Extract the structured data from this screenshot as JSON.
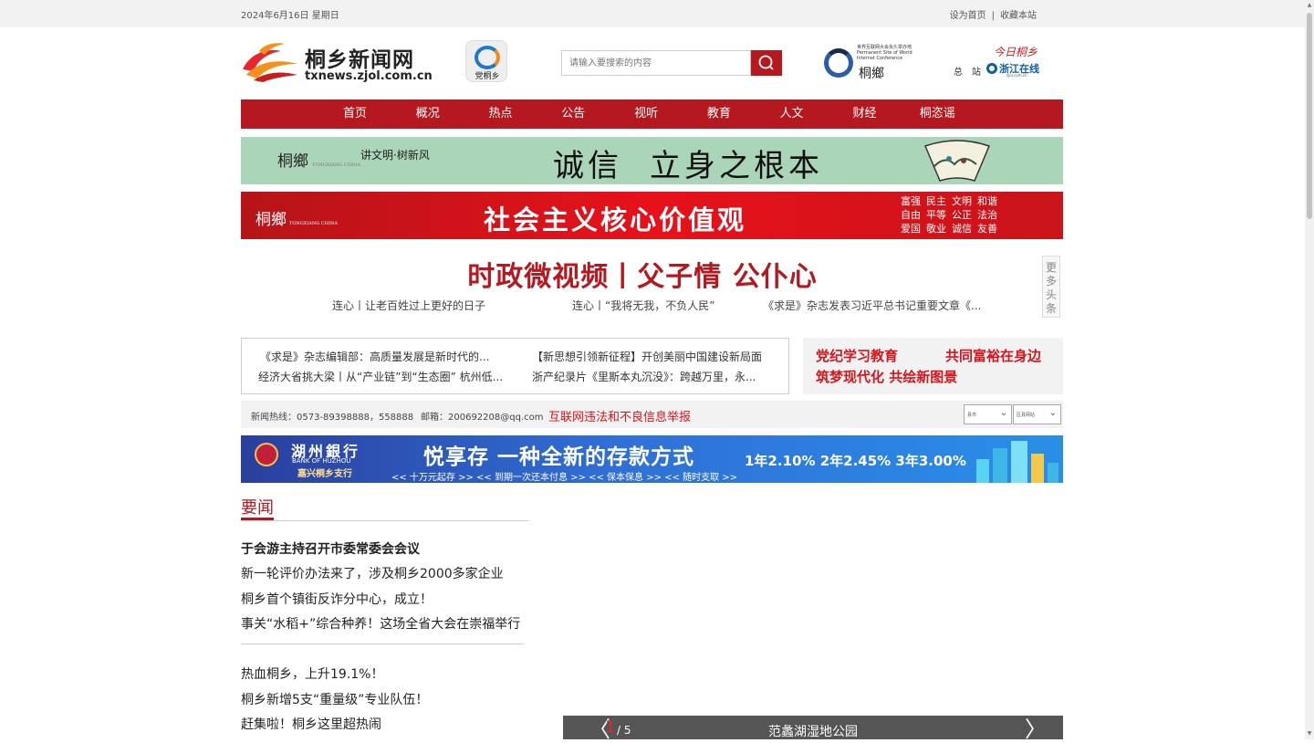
{
  "topbar": {
    "date": "2024年6月16日 星期日",
    "set_home": "设为首页",
    "divider": "|",
    "bookmark": "收藏本站"
  },
  "logo": {
    "name": "桐乡新闻网",
    "domain": "txnews.zjol.com.cn",
    "icon": "flame-swoosh-logo"
  },
  "party_badge": {
    "text": "党桐乡",
    "icon": "party-circle-icon"
  },
  "search": {
    "placeholder": "请输入要搜索的内容",
    "icon": "search-icon"
  },
  "wic": {
    "caption": "世界互联网大会永久举办地 Permanent Site of World Internet Conference",
    "text": "桐鄉"
  },
  "zjol": {
    "today": "今日桐乡",
    "zong": "总",
    "zhan": "站",
    "brand": "浙江在线",
    "url": "zjol.com.cn"
  },
  "nav": [
    "首页",
    "概况",
    "热点",
    "公告",
    "视听",
    "教育",
    "人文",
    "财经",
    "桐恣谣"
  ],
  "banner1": {
    "seal": "桐鄉",
    "seal_small": "TONGXIANG CHINA",
    "slogan_small": "讲文明·树新风",
    "slogan_a": "诚信",
    "slogan_b": "立身之根本"
  },
  "banner2": {
    "seal": "桐鄉",
    "seal_small": "TONGXIANG CHINA",
    "title": "社会主义核心价值观",
    "values": [
      [
        "富强",
        "民主",
        "文明",
        "和谐"
      ],
      [
        "自由",
        "平等",
        "公正",
        "法治"
      ],
      [
        "爱国",
        "敬业",
        "诚信",
        "友善"
      ]
    ]
  },
  "headline": "时政微视频丨父子情 公仆心",
  "subheads": [
    "连心丨让老百姓过上更好的日子",
    "连心丨“我将无我，不负人民”",
    "《求是》杂志发表习近平总书记重要文章《..."
  ],
  "more_tab": [
    "更",
    "多",
    "头",
    "条"
  ],
  "newsbox": [
    "《求是》杂志编辑部：高质量发展是新时代的...",
    "【新思想引领新征程】开创美丽中国建设新局面",
    "经济大省挑大梁丨从“产业链”到“生态圈” 杭州低...",
    "浙产纪录片《里斯本丸沉没》：跨越万里，永..."
  ],
  "promo": [
    "党纪学习教育",
    "共同富裕在身边",
    "筑梦现代化 共绘新图景"
  ],
  "infobar": {
    "hotline": "新闻热线：0573-89398888，558888",
    "email": "邮箱：200692208@qq.com",
    "report": "互联网违法和不良信息举报",
    "select1": "县市",
    "select2": "区县网站"
  },
  "bank_ad": {
    "name": "湖州銀行",
    "name_en": "BANK OF HUZHOU",
    "branch": "嘉兴桐乡支行",
    "main": "悦享存 一种全新的存款方式",
    "sub": "<< 十万元起存 >>   << 到期一次还本付息 >>   << 保本保息 >>   << 随时支取 >>",
    "rates": "1年2.10%   2年2.45%   3年3.00%"
  },
  "yaowen": {
    "title": "要闻",
    "group1": [
      "于会游主持召开市委常委会会议",
      "新一轮评价办法来了，涉及桐乡2000多家企业",
      "桐乡首个镇街反诈分中心，成立！",
      "事关“水稻+”综合种养！这场全省大会在崇福举行"
    ],
    "group2": [
      "热血桐乡，上升19.1%！",
      "桐乡新增5支“重量级”专业队伍！",
      "赶集啦！桐乡这里超热闹"
    ]
  },
  "slider": {
    "current": "1",
    "total": "/ 5",
    "caption": "范蠡湖湿地公园",
    "prev": "〈",
    "next": "〉"
  },
  "colors": {
    "brand_red": "#b5191f",
    "promo_red": "#d6141c",
    "banner_green": "#abd5b8"
  }
}
